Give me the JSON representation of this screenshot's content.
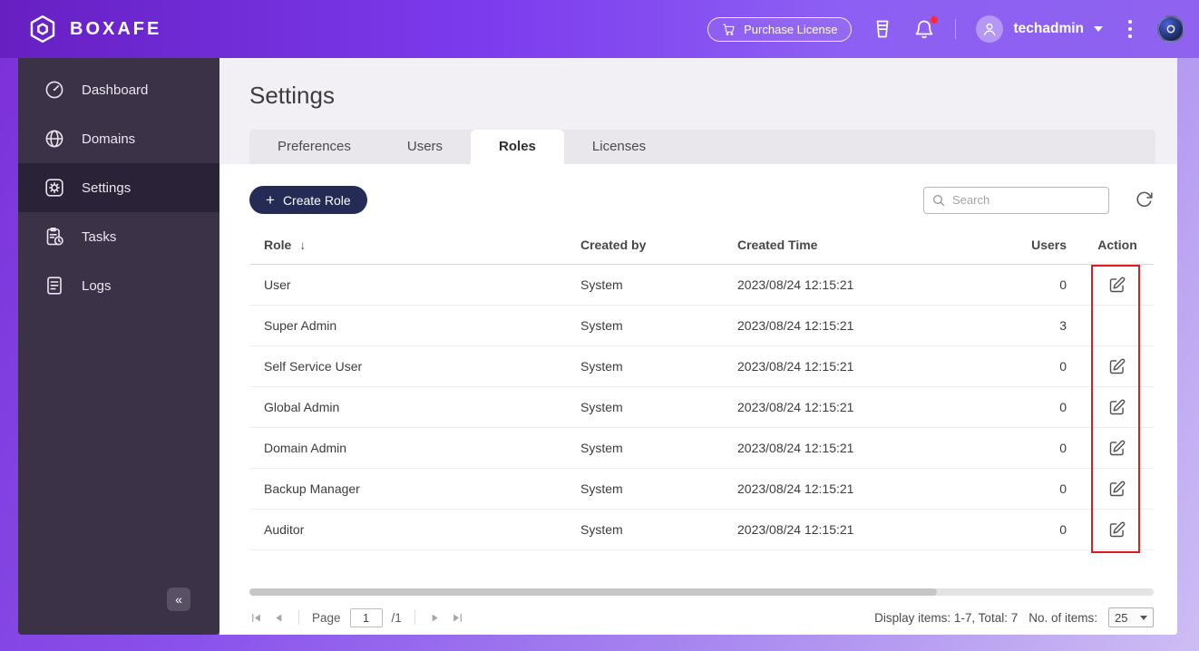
{
  "header": {
    "brand": "BOXAFE",
    "purchase_license_label": "Purchase License",
    "username": "techadmin"
  },
  "sidebar": {
    "items": [
      {
        "label": "Dashboard",
        "active": false
      },
      {
        "label": "Domains",
        "active": false
      },
      {
        "label": "Settings",
        "active": true
      },
      {
        "label": "Tasks",
        "active": false
      },
      {
        "label": "Logs",
        "active": false
      }
    ],
    "collapse_label": "«"
  },
  "page": {
    "title": "Settings",
    "tabs": [
      {
        "label": "Preferences",
        "active": false
      },
      {
        "label": "Users",
        "active": false
      },
      {
        "label": "Roles",
        "active": true
      },
      {
        "label": "Licenses",
        "active": false
      }
    ]
  },
  "toolbar": {
    "create_role_plus": "+",
    "create_role_label": "Create Role",
    "search_placeholder": "Search"
  },
  "table": {
    "columns": {
      "role": "Role",
      "sort_arrow": "↓",
      "created_by": "Created by",
      "created_time": "Created Time",
      "users": "Users",
      "action": "Action"
    },
    "rows": [
      {
        "role": "User",
        "created_by": "System",
        "created_time": "2023/08/24 12:15:21",
        "users": "0",
        "editable": true
      },
      {
        "role": "Super Admin",
        "created_by": "System",
        "created_time": "2023/08/24 12:15:21",
        "users": "3",
        "editable": false
      },
      {
        "role": "Self Service User",
        "created_by": "System",
        "created_time": "2023/08/24 12:15:21",
        "users": "0",
        "editable": true
      },
      {
        "role": "Global Admin",
        "created_by": "System",
        "created_time": "2023/08/24 12:15:21",
        "users": "0",
        "editable": true
      },
      {
        "role": "Domain Admin",
        "created_by": "System",
        "created_time": "2023/08/24 12:15:21",
        "users": "0",
        "editable": true
      },
      {
        "role": "Backup Manager",
        "created_by": "System",
        "created_time": "2023/08/24 12:15:21",
        "users": "0",
        "editable": true
      },
      {
        "role": "Auditor",
        "created_by": "System",
        "created_time": "2023/08/24 12:15:21",
        "users": "0",
        "editable": true
      }
    ]
  },
  "pagination": {
    "page_label": "Page",
    "current_page": "1",
    "total_pages_label": "/1",
    "display_items": "Display items: 1-7, Total: 7",
    "items_count_label": "No. of items:",
    "items_per_page": "25"
  },
  "icons": {
    "logo": "boxafe-hexagon-logo",
    "purchase": "shopping-cart",
    "queue": "task-queue-glass",
    "notifications": "bell-with-red-dot",
    "user": "person-silhouette",
    "menu": "kebab-dots",
    "search": "magnifier",
    "refresh": "circular-arrow",
    "sort": "down-arrow",
    "edit": "pencil-in-square",
    "collapse": "double-chevron-left"
  },
  "colors": {
    "header_gradient_start": "#671fc2",
    "header_gradient_end": "#8f63f0",
    "sidebar_bg": "#3b3248",
    "sidebar_active_bg": "#2a2237",
    "accent_navy": "#242b55",
    "tab_strip_gray": "#e9e6ec",
    "highlight_red": "#e11b22"
  }
}
